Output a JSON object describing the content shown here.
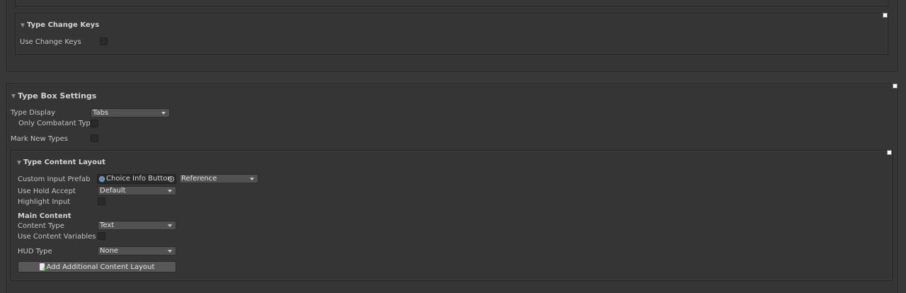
{
  "type_change_keys": {
    "title": "Type Change Keys",
    "use_change_keys_label": "Use Change Keys"
  },
  "type_box_settings": {
    "title": "Type Box Settings",
    "type_display_label": "Type Display",
    "type_display_value": "Tabs",
    "only_combatant_types_label": "Only Combatant Types",
    "mark_new_types_label": "Mark New Types"
  },
  "type_content_layout": {
    "title": "Type Content Layout",
    "custom_input_prefab_label": "Custom Input Prefab",
    "custom_input_prefab_value": "Choice Info Button",
    "reference_value": "Reference",
    "use_hold_accept_label": "Use Hold Accept",
    "use_hold_accept_value": "Default",
    "highlight_input_label": "Highlight Input",
    "main_content_header": "Main Content",
    "content_type_label": "Content Type",
    "content_type_value": "Text",
    "use_content_variables_label": "Use Content Variables",
    "hud_type_label": "HUD Type",
    "hud_type_value": "None",
    "add_layout_button": "Add Additional Content Layout"
  },
  "icons": {
    "foldout": "triangle-down-icon",
    "object": "prefab-icon",
    "picker": "object-picker-icon",
    "add": "add-document-icon"
  }
}
